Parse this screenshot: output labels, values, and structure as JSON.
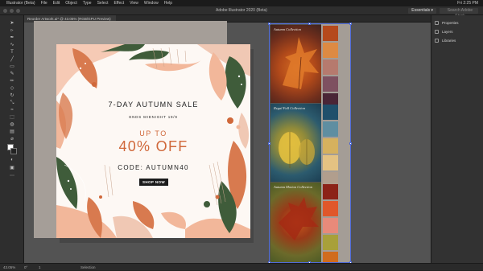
{
  "menubar": {
    "apple": "",
    "items": [
      "Illustrator (Beta)",
      "File",
      "Edit",
      "Object",
      "Type",
      "Select",
      "Effect",
      "View",
      "Window",
      "Help"
    ],
    "clock": "Fri 2:25 PM"
  },
  "titlebar": {
    "title": "Adobe Illustrator 2020 (Beta)",
    "workspace": "Essentials",
    "workspace_chevron": "▾",
    "search_placeholder": "Search Adobe Stock"
  },
  "document": {
    "tab_label": "Reorder Artwork.ai* @ 43.05% (RGB/GPU Preview)"
  },
  "right_panel": {
    "items": [
      "Properties",
      "Layers",
      "Libraries"
    ]
  },
  "card": {
    "title": "7-DAY AUTUMN SALE",
    "ends": "ENDS MIDNIGHT 19/9",
    "upto": "UP TO",
    "discount": "40% OFF",
    "code": "CODE: AUTUMN40",
    "cta": "SHOP NOW",
    "colors": {
      "accent": "#d0683a",
      "dark_green": "#3f5c3a",
      "peach": "#f2b79a",
      "terracotta": "#d87a4f",
      "blush": "#f0c8b4"
    }
  },
  "collections": [
    {
      "label": "Autumn Collection",
      "swatches": [
        "#b5491c",
        "#dd8a43",
        "#b67a6e",
        "#7e5060",
        "#4a2536",
        "#2a2524"
      ]
    },
    {
      "label": "Regal Fall Collection",
      "swatches": [
        "#1f4f6b",
        "#5f8ea1",
        "#d6b15e",
        "#e4c282",
        "#b19e8d",
        "#26262c"
      ]
    },
    {
      "label": "Autumn Motion Collection",
      "swatches": [
        "#8c2318",
        "#e0572a",
        "#e88a7a",
        "#a8a03a",
        "#d06c1e",
        "#b85f1f"
      ]
    }
  ],
  "status": {
    "zoom": "43.05%",
    "rotation": "0°",
    "page": "1",
    "tool": "Selection"
  },
  "tool_icons": [
    "selection-icon",
    "direct-selection-icon",
    "pen-icon",
    "curvature-icon",
    "type-icon",
    "line-icon",
    "rectangle-icon",
    "paintbrush-icon",
    "pencil-icon",
    "eraser-icon",
    "rotate-icon",
    "scale-icon",
    "width-icon",
    "free-transform-icon",
    "shape-builder-icon",
    "perspective-icon",
    "mesh-icon",
    "gradient-icon",
    "eyedropper-icon",
    "blend-icon",
    "symbol-sprayer-icon",
    "graph-icon",
    "artboard-icon",
    "slice-icon",
    "hand-icon",
    "zoom-icon"
  ]
}
